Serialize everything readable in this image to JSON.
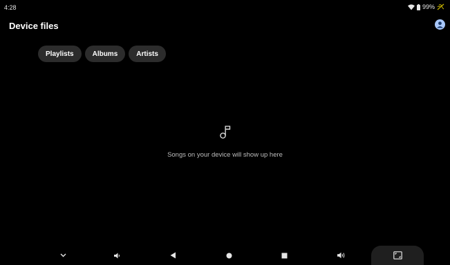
{
  "status_bar": {
    "time": "4:28",
    "battery_percent": "99%",
    "icons": [
      "wifi-icon",
      "battery-icon",
      "no-charge-icon"
    ]
  },
  "app_bar": {
    "title": "Device files",
    "avatar_icon": "account-icon"
  },
  "chips": [
    {
      "label": "Playlists"
    },
    {
      "label": "Albums"
    },
    {
      "label": "Artists"
    }
  ],
  "empty_state": {
    "icon": "music-note-icon",
    "message": "Songs on your device will show up here"
  },
  "nav_bar": {
    "buttons": [
      "hide-keyboard-icon",
      "volume-down-icon",
      "back-icon",
      "home-icon",
      "recents-icon",
      "volume-up-icon",
      "rotate-screen-icon"
    ]
  },
  "colors": {
    "background": "#000000",
    "chip_background": "#2c2c2c",
    "avatar": "#a8c7fa",
    "secondary_text": "#bdbdbd",
    "charging_icon": "#c8b400"
  }
}
